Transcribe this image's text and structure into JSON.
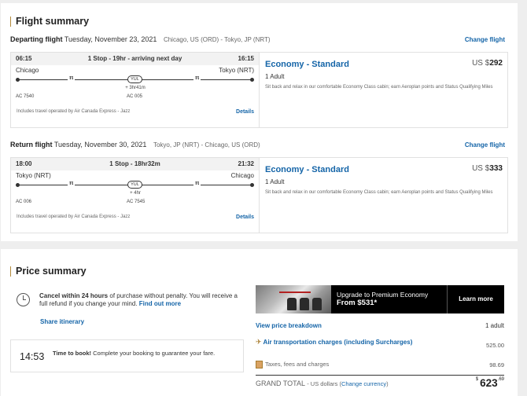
{
  "flight_summary": {
    "title": "Flight summary",
    "departing": {
      "label": "Departing flight",
      "date": "Tuesday, November 23, 2021",
      "route": "Chicago, US (ORD) - Tokyo, JP (NRT)",
      "change": "Change flight",
      "depart_time": "06:15",
      "stops": "1 Stop - 19hr - arriving next day",
      "arrive_time": "16:15",
      "origin": "Chicago",
      "destination": "Tokyo (NRT)",
      "connection_airport": "YUL",
      "layover": "+ 3hr41m",
      "flight1": "AC 7540",
      "flight2": "AC 005",
      "operated": "Includes travel operated by Air Canada Express - Jazz",
      "details": "Details",
      "fare_name": "Economy - Standard",
      "currency": "US $",
      "price": "292",
      "pax": "1 Adult",
      "desc": "Sit back and relax in our comfortable Economy Class cabin; earn Aeroplan points and Status Qualifying Miles"
    },
    "return": {
      "label": "Return flight",
      "date": "Tuesday, November 30, 2021",
      "route": "Tokyo, JP (NRT) - Chicago, US (ORD)",
      "change": "Change flight",
      "depart_time": "18:00",
      "stops": "1 Stop - 18hr32m",
      "arrive_time": "21:32",
      "origin": "Tokyo (NRT)",
      "destination": "Chicago",
      "connection_airport": "YUL",
      "layover": "+ 4hr",
      "flight1": "AC 006",
      "flight2": "AC 7545",
      "operated": "Includes travel operated by Air Canada Express - Jazz",
      "details": "Details",
      "fare_name": "Economy - Standard",
      "currency": "US $",
      "price": "333",
      "pax": "1 Adult",
      "desc": "Sit back and relax in our comfortable Economy Class cabin; earn Aeroplan points and Status Qualifying Miles"
    }
  },
  "price_summary": {
    "title": "Price summary",
    "cancel_bold": "Cancel within 24 hours",
    "cancel_rest": " of purchase without penalty. You will receive a full refund if you change your mind.",
    "find_out_more": "Find out more",
    "share": "Share itinerary",
    "timer": "14:53",
    "timer_bold": "Time to book!",
    "timer_rest": " Complete your booking to guarantee your fare.",
    "upgrade_line1": "Upgrade to Premium Economy",
    "upgrade_line2": "From $531*",
    "learn_more": "Learn more",
    "view_breakdown": "View price breakdown",
    "adult": "1 adult",
    "air_label": "Air transportation charges (including Surcharges)",
    "air_value": "525.00",
    "tax_label": "Taxes, fees and charges",
    "tax_value": "98.69",
    "grand_label": "GRAND TOTAL",
    "grand_currency": "- US dollars (",
    "change_currency": "Change currency",
    "grand_currency_close": ")",
    "grand_symbol": "$",
    "grand_whole": "623",
    "grand_cents": ".69"
  }
}
